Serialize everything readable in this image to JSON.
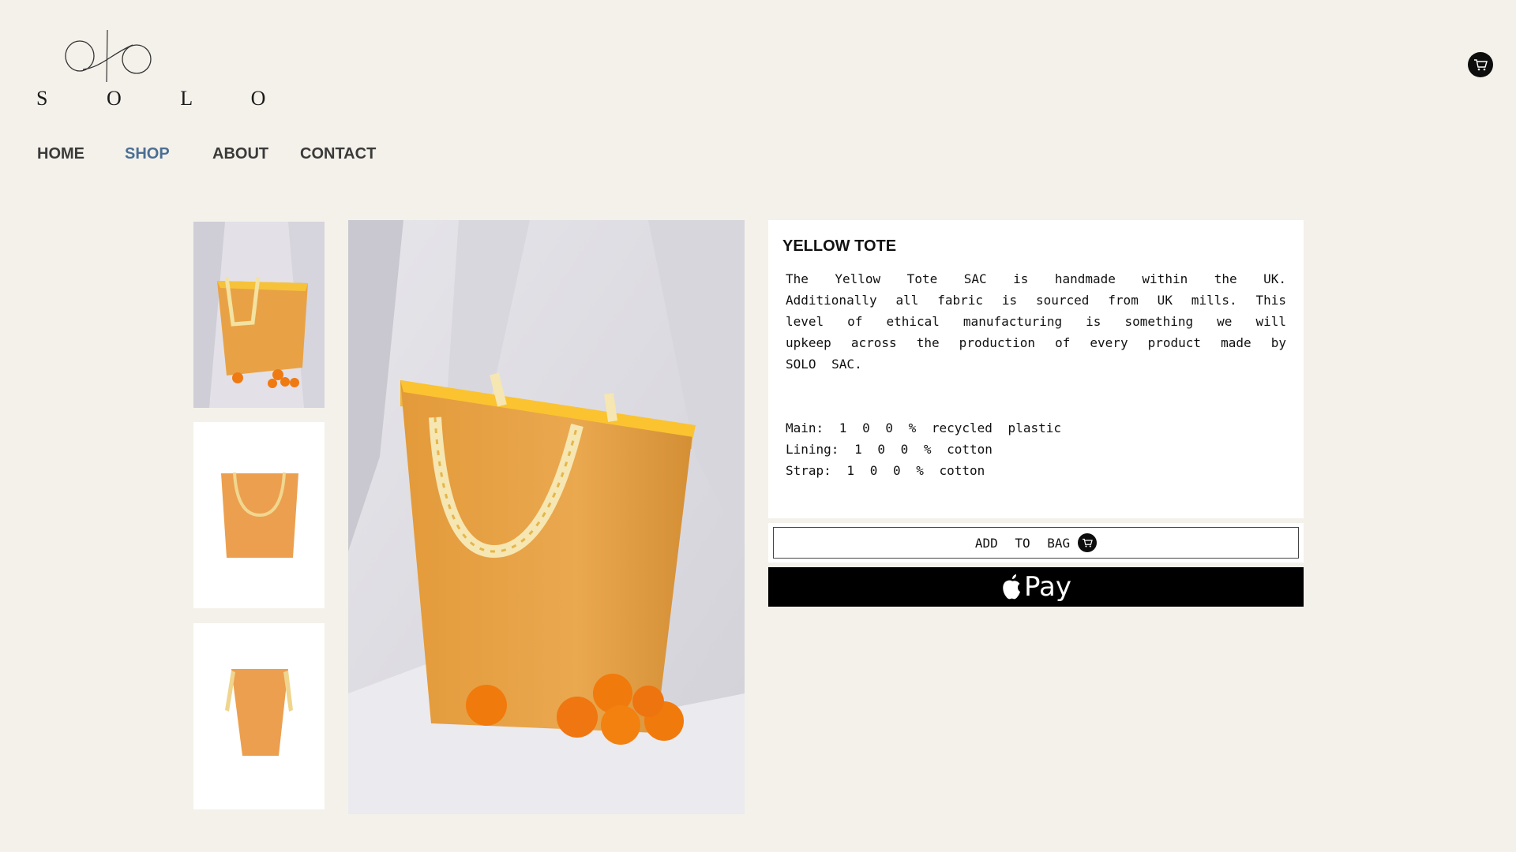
{
  "brand": {
    "logo_text": "S O L O"
  },
  "nav": {
    "items": [
      {
        "label": "HOME"
      },
      {
        "label": "SHOP"
      },
      {
        "label": "ABOUT"
      },
      {
        "label": "CONTACT"
      }
    ],
    "active": "SHOP"
  },
  "product": {
    "title": "YELLOW TOTE",
    "description": "The Yellow Tote SAC is handmade within the UK. Additionally all fabric is sourced from UK mills.  This level of ethical manufacturing is something we will upkeep across the production of every product made by SOLO SAC.",
    "materials": [
      "Main: 1 0 0 % recycled plastic",
      "Lining: 1 0 0 % cotton",
      "Strap: 1 0 0 % cotton"
    ],
    "add_to_bag_label": "ADD TO BAG",
    "apple_pay_label": "Pay"
  },
  "icons": {
    "cart": "cart-icon",
    "apple": "apple-icon"
  },
  "colors": {
    "background": "#f4f1ea",
    "nav_active": "#4b6f94",
    "tote": "#e9a64a",
    "black": "#000000"
  }
}
